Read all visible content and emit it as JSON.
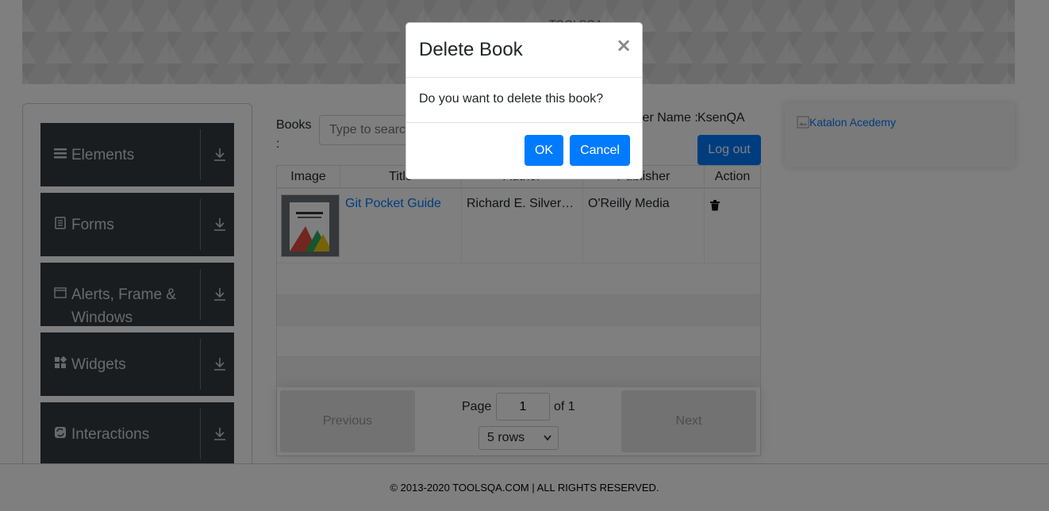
{
  "header": {
    "logo_text": "TOOLSQA"
  },
  "sidebar": {
    "groups": [
      {
        "label": "Elements",
        "icon": "menu-icon"
      },
      {
        "label": "Forms",
        "icon": "document-icon"
      },
      {
        "label": "Alerts, Frame & Windows",
        "icon": "window-icon"
      },
      {
        "label": "Widgets",
        "icon": "widgets-icon"
      },
      {
        "label": "Interactions",
        "icon": "interactions-icon"
      }
    ]
  },
  "books": {
    "label": "Books :",
    "search_placeholder": "Type to search",
    "user_label": "User Name :",
    "user_value": "KsenQA",
    "logout_label": "Log out",
    "columns": [
      "Image",
      "Title",
      "Author",
      "Publisher",
      "Action"
    ],
    "rows": [
      {
        "title": "Git Pocket Guide",
        "author": "Richard E. Silverman",
        "publisher": "O'Reilly Media"
      }
    ],
    "pager": {
      "previous_label": "Previous",
      "next_label": "Next",
      "page_label": "Page",
      "page_value": "1",
      "of_label": "of 1",
      "rows_option": "5 rows"
    }
  },
  "ad": {
    "alt_text": "Katalon Acedemy"
  },
  "footer": {
    "text": "© 2013-2020 TOOLSQA.COM | ALL RIGHTS RESERVED."
  },
  "modal": {
    "title": "Delete Book",
    "close_glyph": "×",
    "body": "Do you want to delete this book?",
    "ok_label": "OK",
    "cancel_label": "Cancel"
  },
  "colors": {
    "primary": "#007bff",
    "sidebar_bg": "#343a40",
    "overlay": "rgba(0,0,0,0.5)"
  }
}
